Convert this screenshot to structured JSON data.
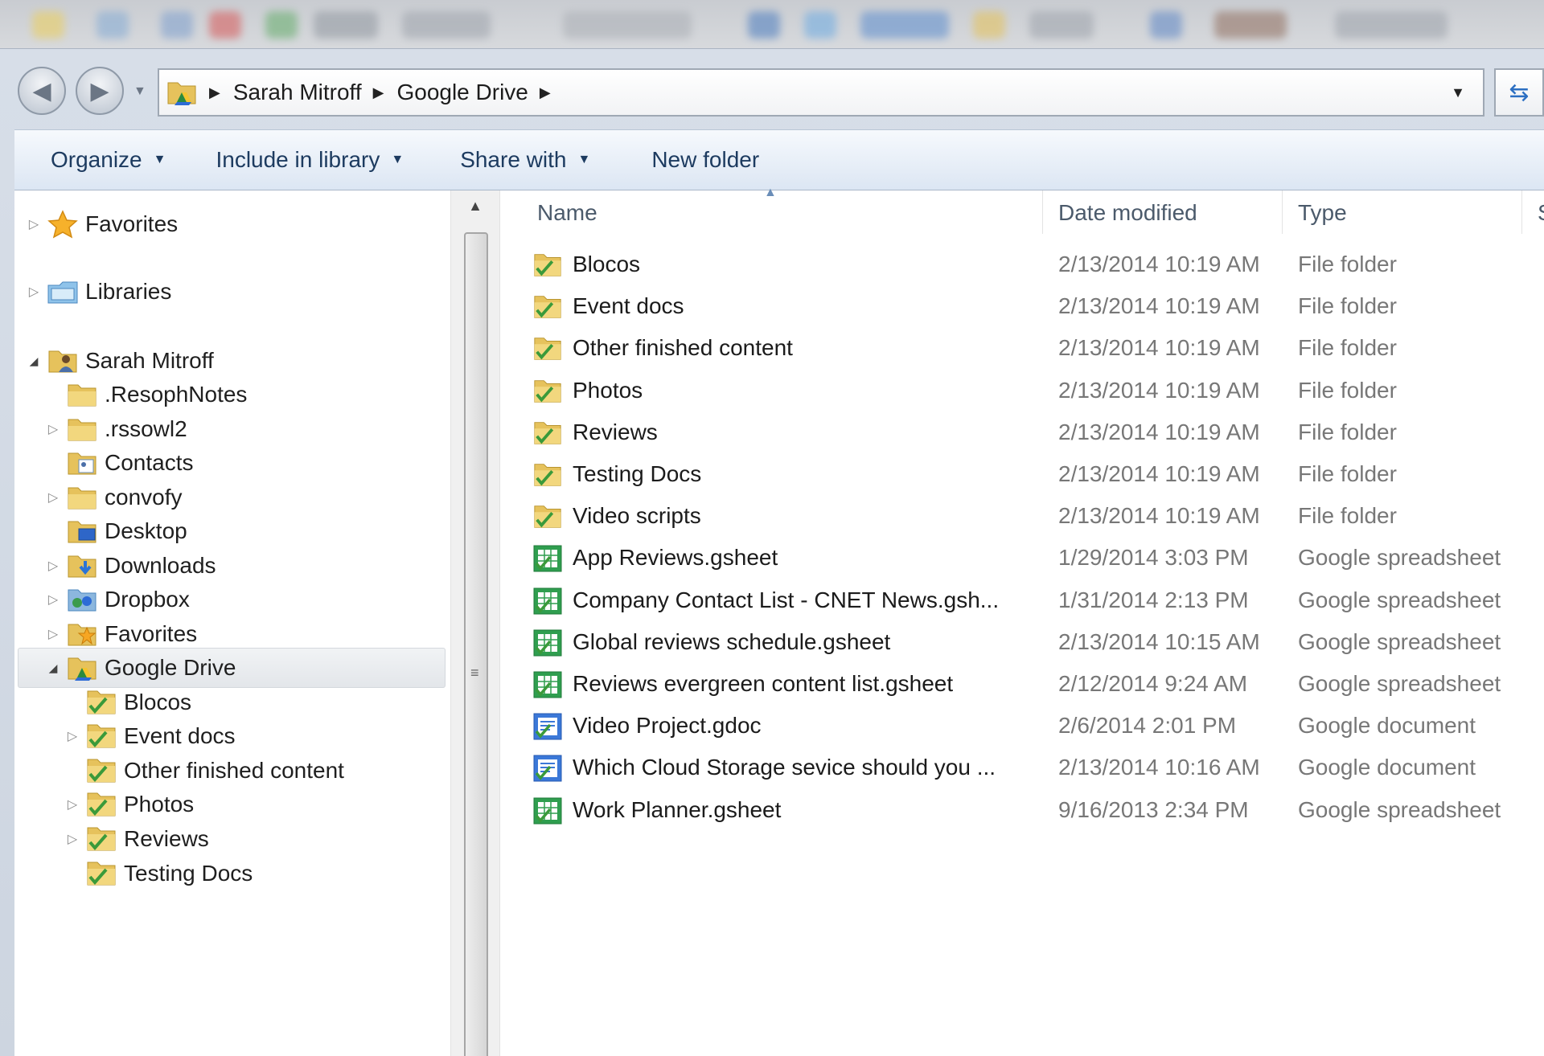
{
  "address": {
    "breadcrumb": [
      "Sarah Mitroff",
      "Google Drive"
    ]
  },
  "toolbar": {
    "organize": "Organize",
    "include_in_library": "Include in library",
    "share_with": "Share with",
    "new_folder": "New folder"
  },
  "nav": {
    "items": [
      {
        "label": "Favorites",
        "icon": "star-icon",
        "level": 0,
        "expander": "collapsed"
      },
      {
        "label": "Libraries",
        "icon": "libraries-icon",
        "level": 0,
        "expander": "collapsed"
      },
      {
        "label": "Sarah Mitroff",
        "icon": "user-folder-icon",
        "level": 0,
        "expander": "expanded"
      },
      {
        "label": ".ResophNotes",
        "icon": "folder-icon",
        "level": 1,
        "expander": "none"
      },
      {
        "label": ".rssowl2",
        "icon": "folder-icon",
        "level": 1,
        "expander": "collapsed"
      },
      {
        "label": "Contacts",
        "icon": "contacts-folder-icon",
        "level": 1,
        "expander": "none"
      },
      {
        "label": "convofy",
        "icon": "folder-icon",
        "level": 1,
        "expander": "collapsed"
      },
      {
        "label": "Desktop",
        "icon": "desktop-folder-icon",
        "level": 1,
        "expander": "none"
      },
      {
        "label": "Downloads",
        "icon": "downloads-folder-icon",
        "level": 1,
        "expander": "collapsed"
      },
      {
        "label": "Dropbox",
        "icon": "dropbox-icon",
        "level": 1,
        "expander": "collapsed"
      },
      {
        "label": "Favorites",
        "icon": "favorites-folder-icon",
        "level": 1,
        "expander": "collapsed"
      },
      {
        "label": "Google Drive",
        "icon": "google-drive-folder-icon",
        "level": 1,
        "expander": "expanded",
        "selected": true
      },
      {
        "label": "Blocos",
        "icon": "synced-folder-icon",
        "level": 2,
        "expander": "none"
      },
      {
        "label": "Event docs",
        "icon": "synced-folder-icon",
        "level": 2,
        "expander": "collapsed"
      },
      {
        "label": "Other finished content",
        "icon": "synced-folder-icon",
        "level": 2,
        "expander": "none"
      },
      {
        "label": "Photos",
        "icon": "synced-folder-icon",
        "level": 2,
        "expander": "collapsed"
      },
      {
        "label": "Reviews",
        "icon": "synced-folder-icon",
        "level": 2,
        "expander": "collapsed"
      },
      {
        "label": "Testing Docs",
        "icon": "synced-folder-icon",
        "level": 2,
        "expander": "none"
      }
    ]
  },
  "columns": {
    "name": "Name",
    "date_modified": "Date modified",
    "type": "Type",
    "size": "Si"
  },
  "files": [
    {
      "name": "Blocos",
      "date": "2/13/2014 10:19 AM",
      "type": "File folder",
      "icon": "synced-folder-icon"
    },
    {
      "name": "Event docs",
      "date": "2/13/2014 10:19 AM",
      "type": "File folder",
      "icon": "synced-folder-icon"
    },
    {
      "name": "Other finished content",
      "date": "2/13/2014 10:19 AM",
      "type": "File folder",
      "icon": "synced-folder-icon"
    },
    {
      "name": "Photos",
      "date": "2/13/2014 10:19 AM",
      "type": "File folder",
      "icon": "synced-folder-icon"
    },
    {
      "name": "Reviews",
      "date": "2/13/2014 10:19 AM",
      "type": "File folder",
      "icon": "synced-folder-icon"
    },
    {
      "name": "Testing Docs",
      "date": "2/13/2014 10:19 AM",
      "type": "File folder",
      "icon": "synced-folder-icon"
    },
    {
      "name": "Video scripts",
      "date": "2/13/2014 10:19 AM",
      "type": "File folder",
      "icon": "synced-folder-icon"
    },
    {
      "name": "App Reviews.gsheet",
      "date": "1/29/2014 3:03 PM",
      "type": "Google spreadsheet",
      "icon": "spreadsheet-icon"
    },
    {
      "name": "Company Contact List - CNET News.gsh...",
      "date": "1/31/2014 2:13 PM",
      "type": "Google spreadsheet",
      "icon": "spreadsheet-icon"
    },
    {
      "name": "Global reviews schedule.gsheet",
      "date": "2/13/2014 10:15 AM",
      "type": "Google spreadsheet",
      "icon": "spreadsheet-icon"
    },
    {
      "name": "Reviews evergreen content list.gsheet",
      "date": "2/12/2014 9:24 AM",
      "type": "Google spreadsheet",
      "icon": "spreadsheet-icon"
    },
    {
      "name": "Video Project.gdoc",
      "date": "2/6/2014 2:01 PM",
      "type": "Google document",
      "icon": "document-icon"
    },
    {
      "name": "Which Cloud Storage sevice should you ...",
      "date": "2/13/2014 10:16 AM",
      "type": "Google document",
      "icon": "document-icon"
    },
    {
      "name": "Work Planner.gsheet",
      "date": "9/16/2013 2:34 PM",
      "type": "Google spreadsheet",
      "icon": "spreadsheet-icon"
    }
  ]
}
